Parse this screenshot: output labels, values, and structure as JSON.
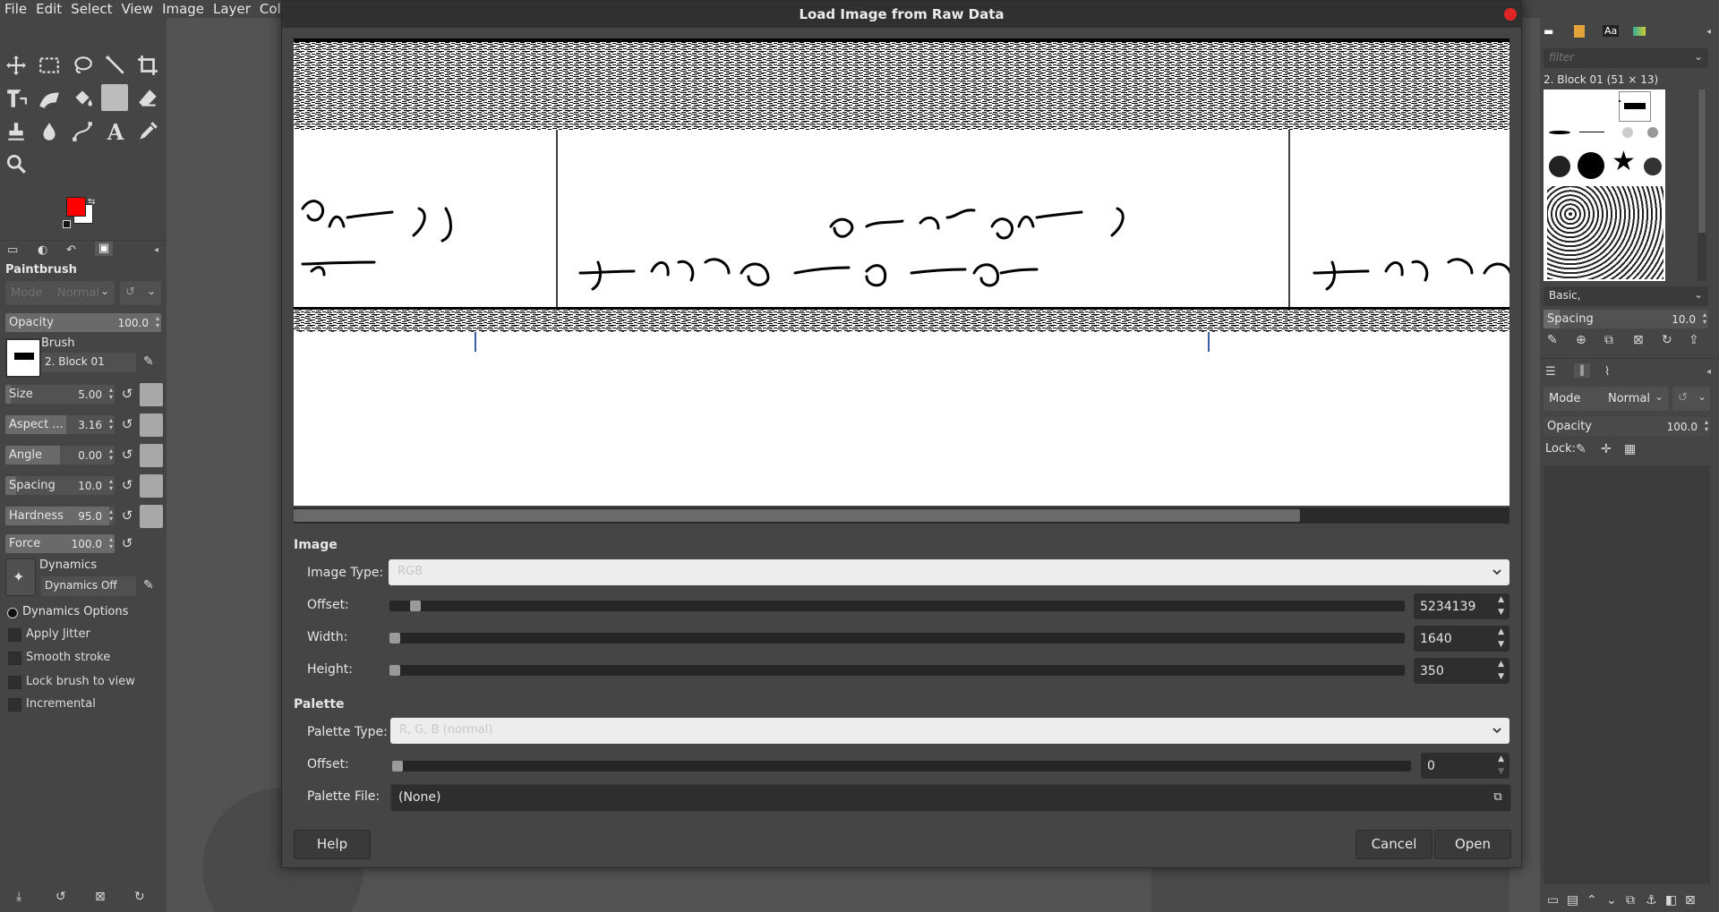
{
  "menubar": {
    "items": [
      "File",
      "Edit",
      "Select",
      "View",
      "Image",
      "Layer",
      "Colo"
    ]
  },
  "colors": {
    "foreground": "#ff0000",
    "background": "#ffffff",
    "accent": "#e02525"
  },
  "tool_options": {
    "title": "Paintbrush",
    "mode_label": "Mode",
    "mode_value": "Normal",
    "opacity": {
      "label": "Opacity",
      "value": "100.0",
      "fraction": 1.0
    },
    "brush_label": "Brush",
    "brush_value": "2. Block 01",
    "size": {
      "label": "Size",
      "value": "5.00",
      "fraction": 0.05
    },
    "aspect": {
      "label": "Aspect ...",
      "value": "3.16",
      "fraction": 0.56
    },
    "angle": {
      "label": "Angle",
      "value": "0.00",
      "fraction": 0.5
    },
    "spacing": {
      "label": "Spacing",
      "value": "10.0",
      "fraction": 0.1
    },
    "hardness": {
      "label": "Hardness",
      "value": "95.0",
      "fraction": 0.95
    },
    "force": {
      "label": "Force",
      "value": "100.0",
      "fraction": 1.0
    },
    "dynamics_label": "Dynamics",
    "dynamics_value": "Dynamics Off",
    "dynamics_options": "Dynamics Options",
    "checks": [
      "Apply Jitter",
      "Smooth stroke",
      "Lock brush to view",
      "Incremental"
    ]
  },
  "brushes_dock": {
    "filter_placeholder": "filter",
    "selected": "2. Block 01 (51 × 13)",
    "preset": "Basic,",
    "spacing_label": "Spacing",
    "spacing_value": "10.0"
  },
  "layers_dock": {
    "mode_label": "Mode",
    "mode_value": "Normal",
    "opacity_label": "Opacity",
    "opacity_value": "100.0",
    "lock_label": "Lock:"
  },
  "dialog": {
    "title": "Load Image from Raw Data",
    "image_section": "Image",
    "image_type_label": "Image Type:",
    "image_type_value": "RGB",
    "offset_label": "Offset:",
    "offset_value": "5234139",
    "width_label": "Width:",
    "width_value": "1640",
    "height_label": "Height:",
    "height_value": "350",
    "palette_section": "Palette",
    "palette_type_label": "Palette Type:",
    "palette_type_value": "R, G, B (normal)",
    "palette_offset_label": "Offset:",
    "palette_offset_value": "0",
    "palette_file_label": "Palette File:",
    "palette_file_value": "(None)",
    "help_label": "Help",
    "cancel_label": "Cancel",
    "open_label": "Open"
  }
}
